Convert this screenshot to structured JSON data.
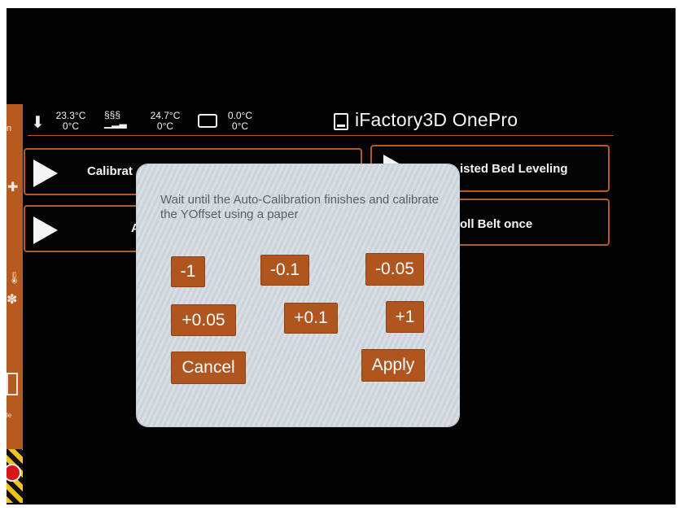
{
  "status": {
    "nozzle": {
      "icon": "nozzle-icon",
      "current": "23.3°C",
      "target": "0°C"
    },
    "bed": {
      "icon": "heated-bed-icon",
      "current": "24.7°C",
      "target": "0°C"
    },
    "chamber": {
      "icon": "chamber-icon",
      "current": "0.0°C",
      "target": "0°C"
    },
    "title": "iFactory3D OnePro"
  },
  "menu": {
    "calibrate_label": "Calibrat",
    "assisted_label": "isted Bed Leveling",
    "second_left_label": "A",
    "roll_label": "oll Belt once"
  },
  "sidebar": {
    "letter_top": "n",
    "label_bottom": "le"
  },
  "dialog": {
    "message": "Wait until the Auto-Calibration finishes and calibrate the YOffset using a paper",
    "buttons": {
      "minus_1": "-1",
      "minus_01": "-0.1",
      "minus_005": "-0.05",
      "plus_005": "+0.05",
      "plus_01": "+0.1",
      "plus_1": "+1",
      "cancel": "Cancel",
      "apply": "Apply"
    }
  },
  "colors": {
    "accent": "#b75a1f",
    "button": "#ae5520",
    "dialog_bg": "#d9dee5",
    "background": "#020202"
  }
}
